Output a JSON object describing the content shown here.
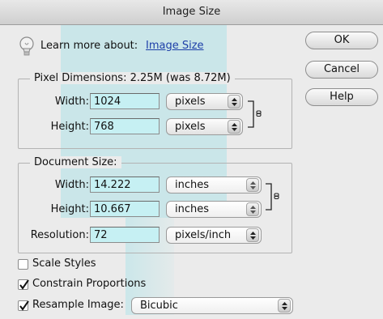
{
  "window": {
    "title": "Image Size"
  },
  "learn": {
    "prefix": "Learn more about:",
    "link": "Image Size"
  },
  "buttons": {
    "ok": "OK",
    "cancel": "Cancel",
    "help": "Help"
  },
  "pixel_dimensions": {
    "legend": "Pixel Dimensions:  2.25M (was 8.72M)",
    "width_label": "Width:",
    "width_value": "1024",
    "width_unit": "pixels",
    "height_label": "Height:",
    "height_value": "768",
    "height_unit": "pixels"
  },
  "document_size": {
    "legend": "Document Size:",
    "width_label": "Width:",
    "width_value": "14.222",
    "width_unit": "inches",
    "height_label": "Height:",
    "height_value": "10.667",
    "height_unit": "inches",
    "resolution_label": "Resolution:",
    "resolution_value": "72",
    "resolution_unit": "pixels/inch"
  },
  "options": {
    "scale_styles": {
      "label": "Scale Styles",
      "checked": false
    },
    "constrain_proportions": {
      "label": "Constrain Proportions",
      "checked": true
    },
    "resample_image": {
      "label": "Resample Image:",
      "checked": true,
      "method": "Bicubic"
    }
  },
  "colors": {
    "field_bg": "#c6f0f3",
    "link": "#1d3fa8",
    "watermark": "#78dce6"
  },
  "icons": [
    "lightbulb-icon",
    "link-chain-icon",
    "popup-arrows-icon",
    "checkmark-icon"
  ]
}
